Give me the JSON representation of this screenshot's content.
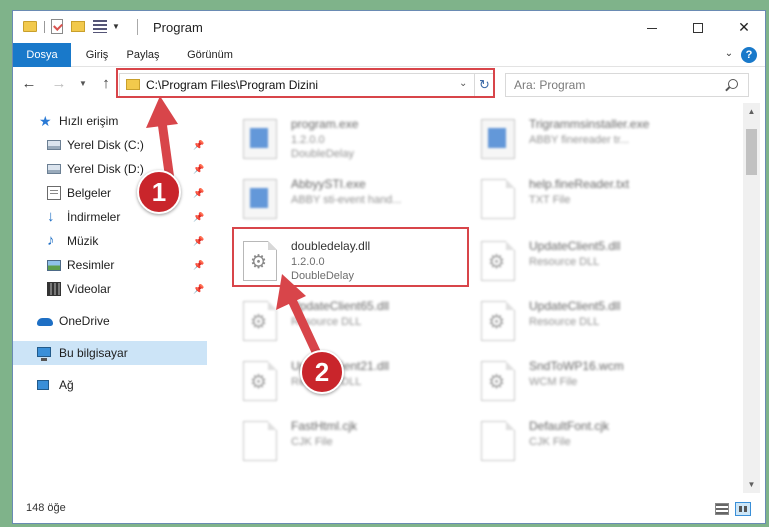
{
  "window": {
    "title": "Program",
    "controls": {
      "minimize": "minimize",
      "maximize": "maximize",
      "close": "✕"
    }
  },
  "ribbon": {
    "tabs": [
      {
        "label": "Dosya",
        "active": true
      },
      {
        "label": "Giriş"
      },
      {
        "label": "Paylaş"
      },
      {
        "label": "Görünüm"
      }
    ],
    "expand_glyph": "⌄",
    "help_glyph": "?"
  },
  "nav": {
    "back": "←",
    "forward": "→",
    "recent": "▼",
    "up": "↑",
    "address": "C:\\Program Files\\Program Dizini",
    "address_dropdown": "⌄",
    "refresh": "↻",
    "search_placeholder": "Ara: Program"
  },
  "sidebar": {
    "items": [
      {
        "label": "Hızlı erişim",
        "icon": "star-icon"
      },
      {
        "label": "Yerel Disk (C:)",
        "icon": "disk-icon",
        "pinned": true
      },
      {
        "label": "Yerel Disk (D:)",
        "icon": "disk-icon",
        "pinned": true
      },
      {
        "label": "Belgeler",
        "icon": "documents-icon",
        "pinned": true
      },
      {
        "label": "İndirmeler",
        "icon": "download-icon",
        "pinned": true
      },
      {
        "label": "Müzik",
        "icon": "music-icon",
        "pinned": true
      },
      {
        "label": "Resimler",
        "icon": "pictures-icon",
        "pinned": true
      },
      {
        "label": "Videolar",
        "icon": "videos-icon",
        "pinned": true
      },
      {
        "label": "OneDrive",
        "icon": "onedrive-icon"
      },
      {
        "label": "Bu bilgisayar",
        "icon": "this-pc-icon",
        "selected": true
      },
      {
        "label": "Ağ",
        "icon": "network-icon"
      }
    ],
    "pin_glyph": "📌"
  },
  "files": [
    {
      "name": "program.exe",
      "line2": "1.2.0.0",
      "line3": "DoubleDelay",
      "icon": "exe-icon",
      "blurred": true
    },
    {
      "name": "Trigrammsinstaller.exe",
      "line2": "ABBY finereader tr...",
      "line3": "",
      "icon": "exe-icon",
      "blurred": true
    },
    {
      "name": "AbbyySTI.exe",
      "line2": "ABBY sti-event hand...",
      "line3": "",
      "icon": "exe-icon",
      "blurred": true
    },
    {
      "name": "help.fineReader.txt",
      "line2": "TXT File",
      "line3": "",
      "icon": "txt-icon",
      "blurred": true
    },
    {
      "name": "doubledelay.dll",
      "line2": "1.2.0.0",
      "line3": "DoubleDelay",
      "icon": "dll-icon",
      "blurred": false
    },
    {
      "name": "UpdateClient5.dll",
      "line2": "Resource DLL",
      "line3": "",
      "icon": "dll-icon",
      "blurred": true
    },
    {
      "name": "UpdateClient65.dll",
      "line2": "Resource DLL",
      "line3": "",
      "icon": "dll-icon",
      "blurred": true
    },
    {
      "name": "UpdateClient5.dll",
      "line2": "Resource DLL",
      "line3": "",
      "icon": "dll-icon",
      "blurred": true
    },
    {
      "name": "UpdateClient21.dll",
      "line2": "Resource DLL",
      "line3": "",
      "icon": "dll-icon",
      "blurred": true
    },
    {
      "name": "SndToWP16.wcm",
      "line2": "WCM File",
      "line3": "",
      "icon": "file-icon",
      "blurred": true
    },
    {
      "name": "FastHtml.cjk",
      "line2": "CJK File",
      "line3": "",
      "icon": "file-icon",
      "blurred": true
    },
    {
      "name": "DefaultFont.cjk",
      "line2": "CJK File",
      "line3": "",
      "icon": "file-icon",
      "blurred": true
    }
  ],
  "status": {
    "item_count": "148 öğe"
  },
  "annotations": {
    "step1": "1",
    "step2": "2",
    "color": "#d8454a"
  }
}
